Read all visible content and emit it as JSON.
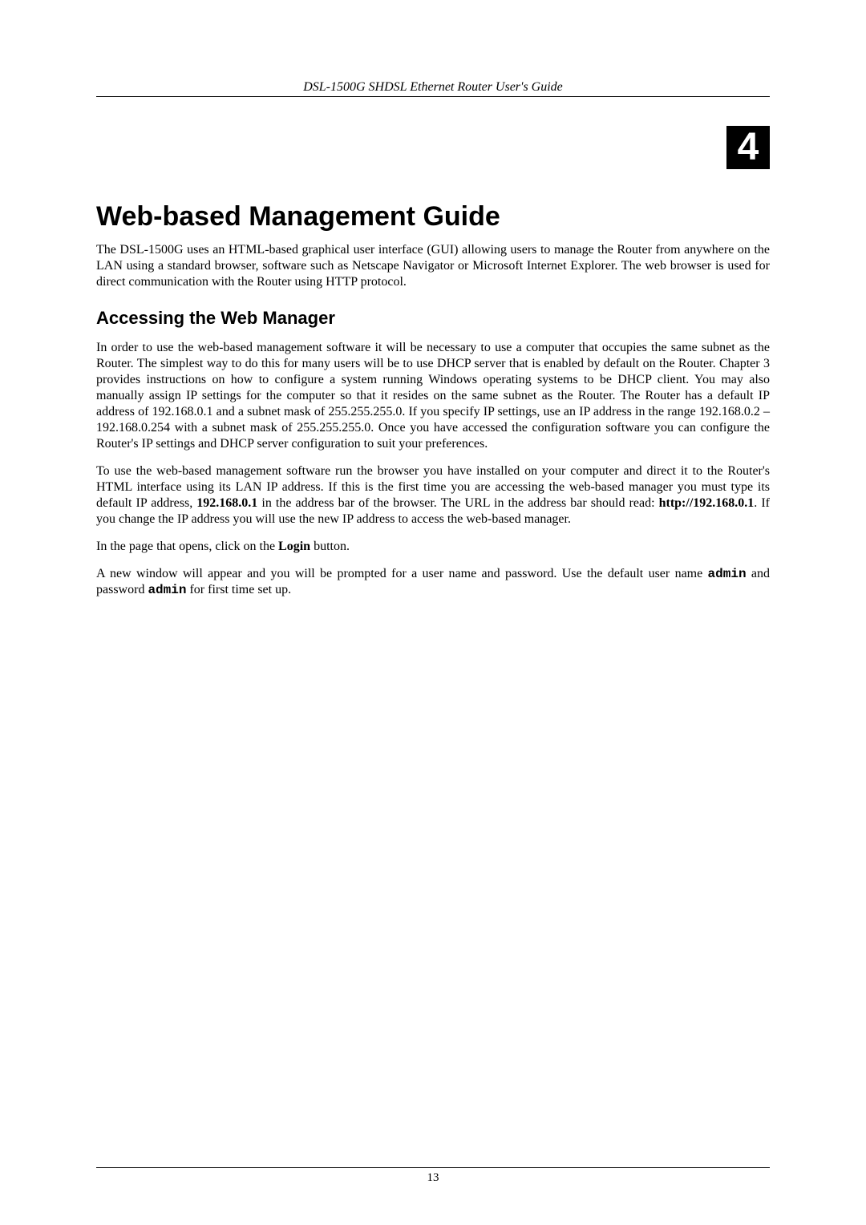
{
  "header": {
    "title": "DSL-1500G SHDSL Ethernet Router User's Guide"
  },
  "chapter": {
    "number": "4"
  },
  "heading": "Web-based Management Guide",
  "intro": "The DSL-1500G uses an HTML-based graphical user interface (GUI) allowing users to manage the Router from anywhere on the LAN using a standard browser, software such as Netscape Navigator or Microsoft Internet Explorer. The web browser is used for direct communication with the Router using HTTP protocol.",
  "section_heading": "Accessing the Web Manager",
  "p1": "In order to use the web-based management software it will be necessary to use a computer that occupies the same subnet as the Router. The simplest way to do this for many users will be to use DHCP server that is enabled by default on the Router. Chapter 3 provides instructions on how to configure a system running Windows operating systems to be DHCP client. You may also manually assign IP settings for the computer so that it resides on the same subnet as the Router. The Router has a default IP address of 192.168.0.1 and a subnet mask of 255.255.255.0. If you specify IP settings, use an IP address in the range 192.168.0.2 – 192.168.0.254 with a subnet mask of 255.255.255.0. Once you have accessed the configuration software you can configure the Router's IP settings and DHCP server configuration to suit your preferences.",
  "p2_a": "To use the web-based management software run the browser you have installed on your computer and direct it to the Router's HTML interface using its LAN IP address. If this is the first time you are accessing the web-based manager you must type its default IP address, ",
  "p2_ip": "192.168.0.1",
  "p2_b": " in the address bar of the browser. The URL in the address bar should read: ",
  "p2_url": "http://192.168.0.1",
  "p2_c": ". If you change the IP address you will use the new IP address to access the web-based manager.",
  "p3_a": "In the page that opens, click on the ",
  "p3_login": "Login",
  "p3_b": " button.",
  "p4_a": "A new window will appear and you will be prompted for a user name and password. Use the default user name ",
  "p4_user": "admin",
  "p4_b": " and password ",
  "p4_pass": "admin",
  "p4_c": " for first time set up.",
  "footer": {
    "page_number": "13"
  }
}
